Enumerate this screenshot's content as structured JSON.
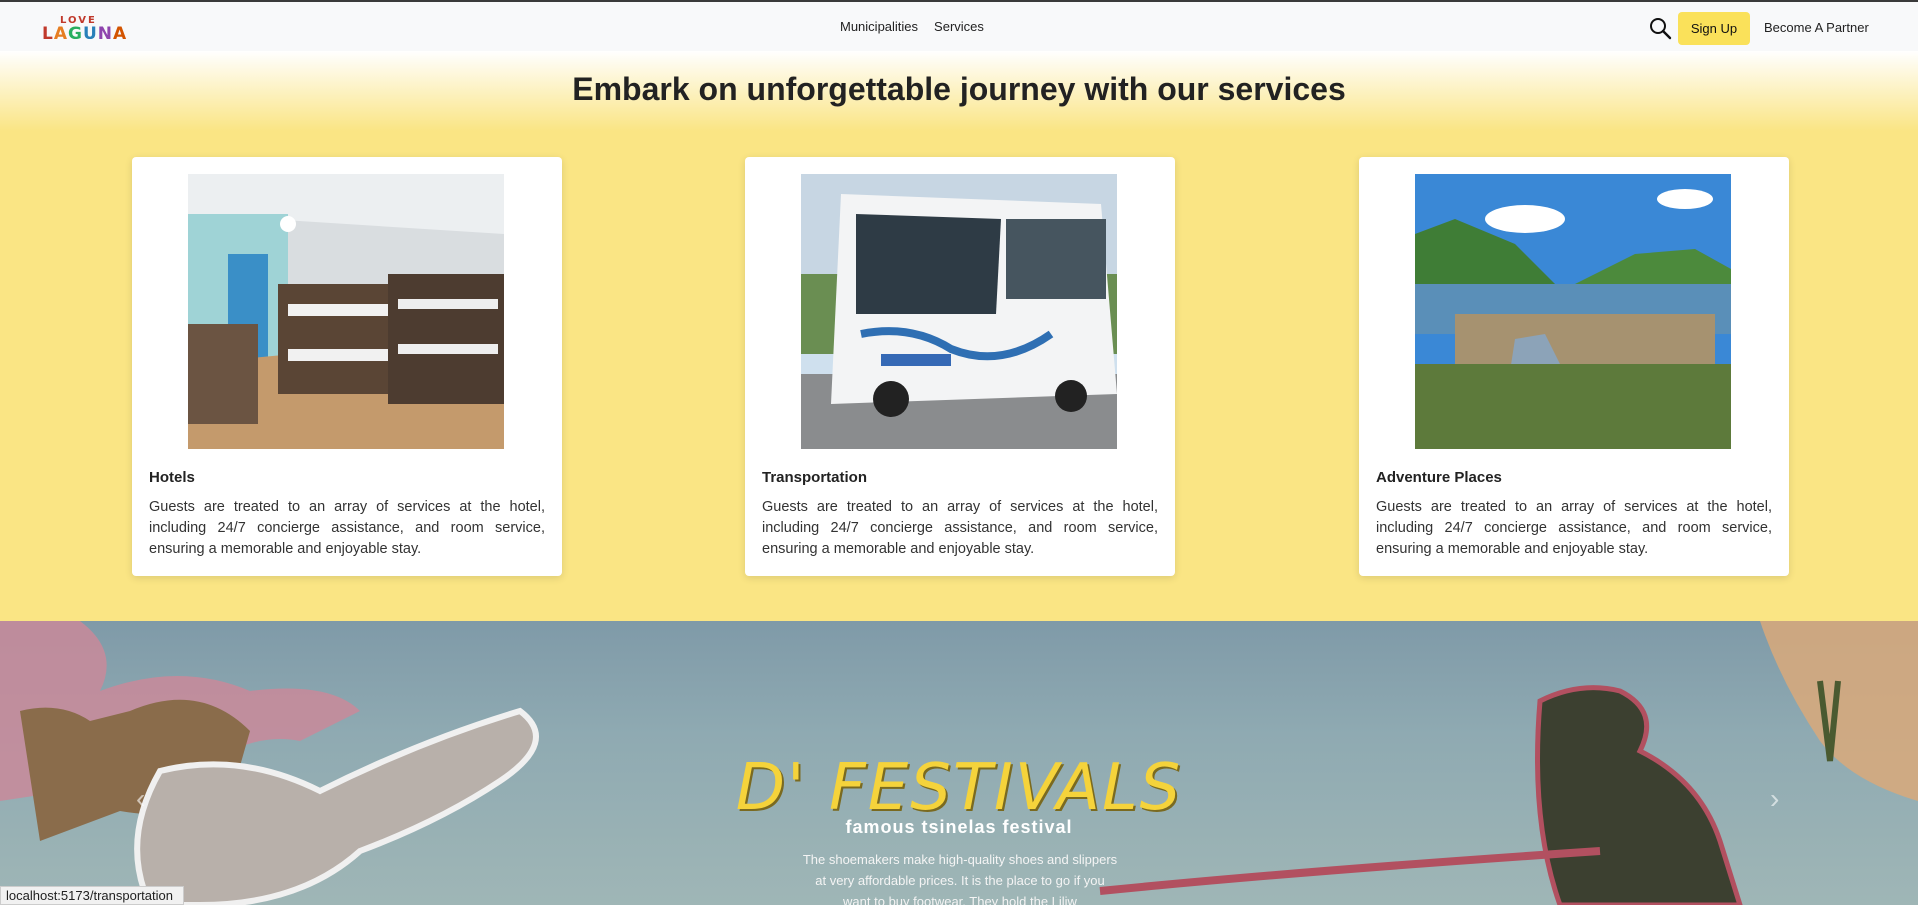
{
  "nav": {
    "logo_love": "LOVE",
    "logo_laguna": [
      "L",
      "A",
      "G",
      "U",
      "N",
      "A"
    ],
    "links": [
      "Municipalities",
      "Services"
    ],
    "signup": "Sign Up",
    "partner": "Become A Partner"
  },
  "services": {
    "heading": "Embark on unforgettable journey with our services",
    "cards": [
      {
        "title": "Hotels",
        "desc": "Guests are treated to an array of services at the hotel, including 24/7 concierge assistance, and room service, ensuring a memorable and enjoyable stay."
      },
      {
        "title": "Transportation",
        "desc": "Guests are treated to an array of services at the hotel, including 24/7 concierge assistance, and room service, ensuring a memorable and enjoyable stay."
      },
      {
        "title": "Adventure Places",
        "desc": "Guests are treated to an array of services at the hotel, including 24/7 concierge assistance, and room service, ensuring a memorable and enjoyable stay."
      }
    ]
  },
  "festival": {
    "title": "D' FESTIVALS",
    "subtitle": "famous tsinelas festival",
    "desc": "The shoemakers make high-quality shoes and slippers at very affordable prices. It is the place to go if you want to buy footwear. They hold the Liliw"
  },
  "status_url": "localhost:5173/transportation",
  "colors": {
    "accent": "#fae15a",
    "section_bg": "#fae584",
    "festival_title": "#f5d33b"
  }
}
